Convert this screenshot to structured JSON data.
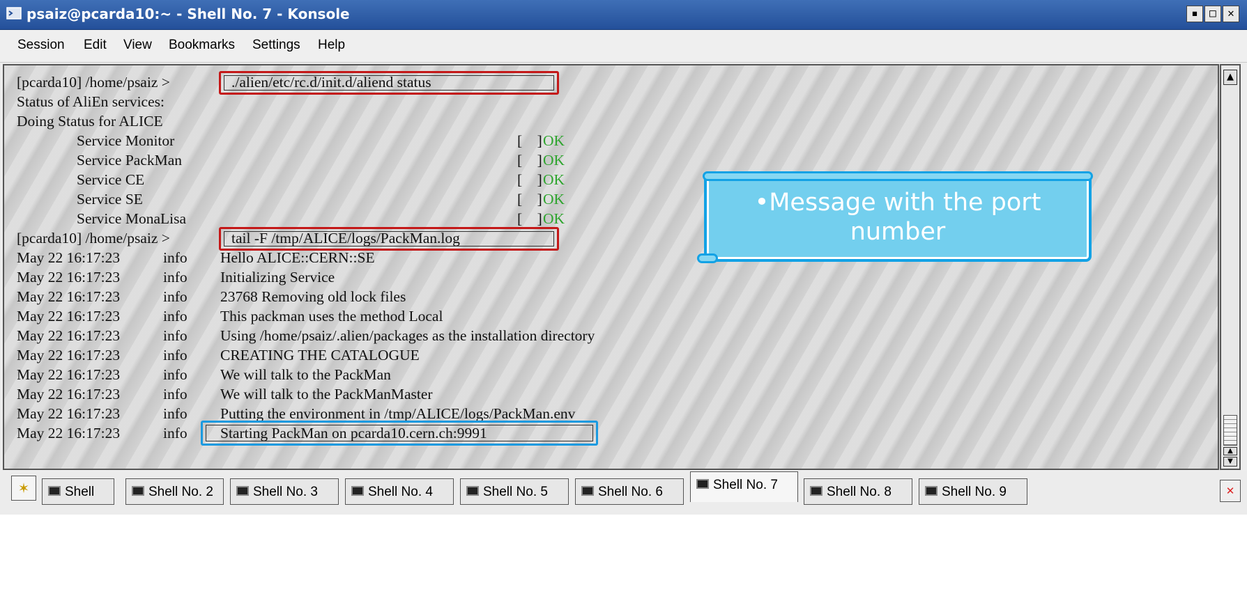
{
  "window": {
    "title": "psaiz@pcarda10:~ - Shell No. 7 - Konsole",
    "buttons": [
      "▪",
      "□",
      "✕"
    ]
  },
  "menubar": {
    "items": [
      "Session",
      "Edit",
      "View",
      "Bookmarks",
      "Settings",
      "Help"
    ]
  },
  "terminal": {
    "prompt1": "[pcarda10] /home/psaiz > ",
    "cmd1": "./alien/etc/rc.d/init.d/aliend status",
    "line_status": "Status of AliEn services:",
    "line_doing": "Doing Status for ALICE",
    "services": [
      {
        "name": "Service Monitor",
        "state": "OK"
      },
      {
        "name": "Service PackMan",
        "state": "OK"
      },
      {
        "name": "Service CE",
        "state": "OK"
      },
      {
        "name": "Service SE",
        "state": "OK"
      },
      {
        "name": "Service MonaLisa",
        "state": "OK"
      }
    ],
    "prompt2": "[pcarda10] /home/psaiz > ",
    "cmd2": "tail -F /tmp/ALICE/logs/PackMan.log",
    "log_timestamp": "May 22 16:17:23",
    "log_level": "info",
    "log_messages": [
      "Hello ALICE::CERN::SE",
      "Initializing Service",
      "23768 Removing old lock files",
      "This packman uses the method Local",
      "Using /home/psaiz/.alien/packages as the installation directory",
      "CREATING THE CATALOGUE",
      "We will talk to the PackMan",
      "We will talk to the PackManMaster",
      "Putting the environment in /tmp/ALICE/logs/PackMan.env",
      "Starting PackMan on pcarda10.cern.ch:9991"
    ]
  },
  "callout": {
    "text": "•Message with the port number"
  },
  "tabs": {
    "items": [
      "Shell",
      "Shell No. 2",
      "Shell No. 3",
      "Shell No. 4",
      "Shell No. 5",
      "Shell No. 6",
      "Shell No. 7",
      "Shell No. 8",
      "Shell No. 9"
    ],
    "active_index": 6
  },
  "colors": {
    "ok": "#2fa52f",
    "highlight_command": "#c41818",
    "highlight_port": "#1a9ae0",
    "callout_fill": "#73cfee"
  }
}
